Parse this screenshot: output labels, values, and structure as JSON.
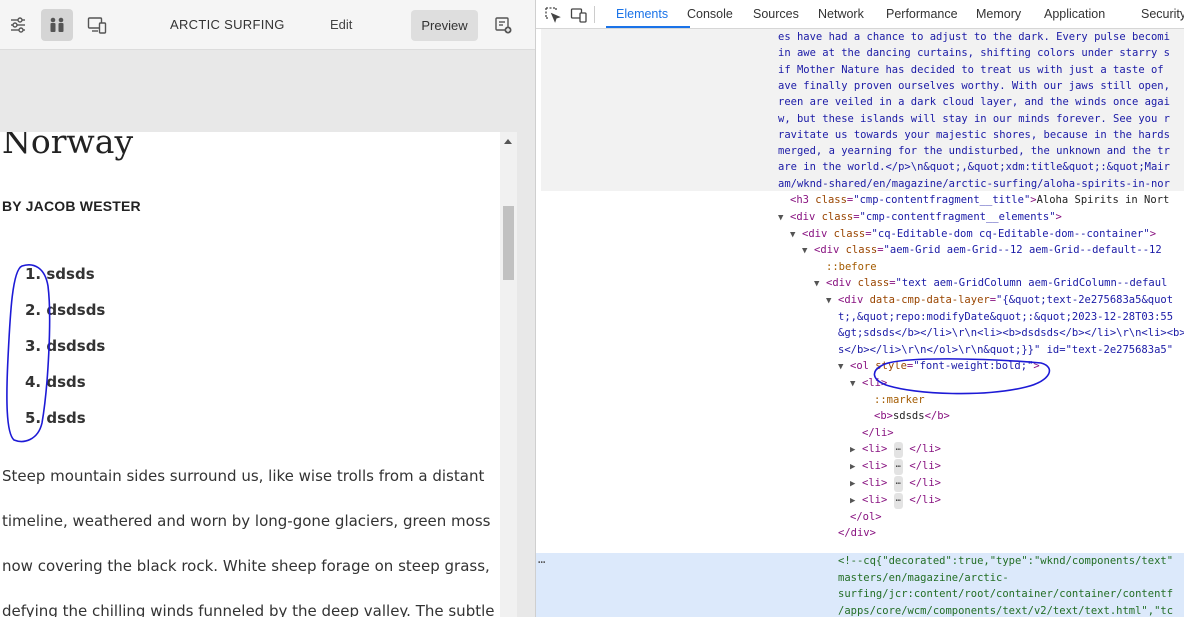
{
  "editor": {
    "toolbar": {
      "site_title": "ARCTIC SURFING",
      "mode_label": "Edit",
      "preview_label": "Preview",
      "icons": [
        "settings-sliders-icon",
        "people-icon",
        "devices-icon",
        "page-add-icon"
      ]
    },
    "article": {
      "title": "Norway",
      "byline": "BY JACOB WESTER",
      "list_items": [
        "1. sdsds",
        "2. dsdsds",
        "3. dsdsds",
        "4. dsds",
        "5. dsds"
      ],
      "body_lines": [
        "Steep mountain sides surround us, like wise trolls from a distant",
        "timeline, weathered and worn by long-gone glaciers, green moss",
        "now covering the black rock. White sheep forage on steep grass,",
        "defying the chilling winds funneled by the deep valley. The subtle"
      ]
    }
  },
  "devtools": {
    "tabs": [
      "Elements",
      "Console",
      "Sources",
      "Network",
      "Performance",
      "Memory",
      "Application",
      "Security"
    ],
    "active_tab": "Elements",
    "text_block": [
      "es have had a chance to adjust to the dark. Every pulse becomi",
      "in awe at the dancing curtains, shifting colors under starry s",
      "if Mother Nature has decided to treat us with just a taste of",
      "ave finally proven ourselves worthy. With our jaws still open,",
      "reen are veiled in a dark cloud layer, and the winds once agai",
      "w, but these islands will stay in our minds forever. See you r",
      "ravitate us towards your majestic shores, because in the hards",
      "merged, a yearning for the undisturbed, the unknown and the tr",
      "are in the world.</p>\\n&quot;,&quot;xdm:title&quot;:&quot;Mair",
      "am/wknd-shared/en/magazine/arctic-surfing/aloha-spirits-in-nor"
    ],
    "h3_title_text": "Aloha Spirits in Nort",
    "nodes": {
      "h3_class": "cmp-contentfragment__title",
      "elements_class": "cmp-contentfragment__elements",
      "editable_class": "cq-Editable-dom cq-Editable-dom--container",
      "grid_class": "aem-Grid aem-Grid--12 aem-Grid--default--12 ",
      "before": "::before",
      "text_class": "text aem-GridColumn aem-GridColumn--defaul",
      "data_layer_1": "{&quot;text-2e275683a5&quot",
      "data_layer_2": "t;,&quot;repo:modifyDate&quot;:&quot;2023-12-28T03:55",
      "data_layer_3": "&gt;sdsds</b></li>\\r\\n<li><b>dsdsds</b></li>\\r\\n<li><b>c",
      "data_layer_4": "s</b></li>\\r\\n</ol>\\r\\n&quot;}}\" id=\"text-2e275683a5\"",
      "ol_style": "font-weight:bold;",
      "marker": "::marker",
      "first_li_text": "sdsds",
      "collapsed_li_count": "4"
    },
    "comment_lines": [
      "<!--cq{\"decorated\":true,\"type\":\"wknd/components/text\"",
      "masters/en/magazine/arctic-",
      "surfing/jcr:content/root/container/container/contentf",
      "/apps/core/wcm/components/text/v2/text/text.html\",\"tc"
    ],
    "dots": "⋯"
  },
  "colors": {
    "annotation": "#1d1ad6",
    "active_tab": "#1a73e8",
    "tag": "#881280",
    "attribute": "#994500",
    "value": "#1a1aa6"
  }
}
